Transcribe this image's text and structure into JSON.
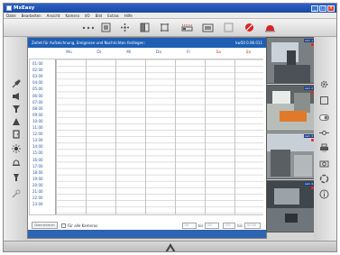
{
  "app": {
    "title": "MxEasy"
  },
  "menu": [
    "Datei",
    "Bearbeiten",
    "Ansicht",
    "Kamera",
    "I/O",
    "Bild",
    "Extras",
    "Hilfe"
  ],
  "toolbar": {
    "icons": [
      "ellipsis-icon",
      "single-view-icon",
      "multi-view-icon",
      "layout-icon",
      "schedule-icon",
      "alarm-icon",
      "settings-panel-icon",
      "record-icon",
      "stop-icon",
      "siren-icon"
    ]
  },
  "notice": {
    "text": "Zeitet für Aufzeichnung, Ereignisse und Nachrichten festlegen:",
    "timestamp": "kw50 0.06.011"
  },
  "schedule": {
    "days": [
      "Mo",
      "Di",
      "Mi",
      "Do",
      "Fr",
      "Sa",
      "So"
    ],
    "weekend_days": [
      "Sa",
      "So"
    ],
    "hours": [
      "01:00",
      "02:00",
      "03:00",
      "04:00",
      "05:00",
      "06:00",
      "07:00",
      "08:00",
      "09:00",
      "10:00",
      "11:00",
      "12:00",
      "13:00",
      "14:00",
      "15:00",
      "16:00",
      "17:00",
      "18:00",
      "19:00",
      "20:00",
      "21:00",
      "22:00",
      "23:00"
    ]
  },
  "bottom": {
    "apply_label": "Übernehmen",
    "checkbox_label": "Für alle Kameras",
    "from_time": "00:",
    "to_time": "00",
    "bis_label_1": "bis",
    "bis_label_2": "bis",
    "date_from": "00:",
    "date_to": "00:00"
  },
  "cameras": [
    {
      "badge": "cam 1"
    },
    {
      "badge": "cam 2"
    },
    {
      "badge": "cam 3"
    },
    {
      "badge": "cam 4"
    }
  ],
  "colors": {
    "accent": "#1e5fb4",
    "weekend": "#d23a1e",
    "titlebar": "#2a62c8"
  }
}
